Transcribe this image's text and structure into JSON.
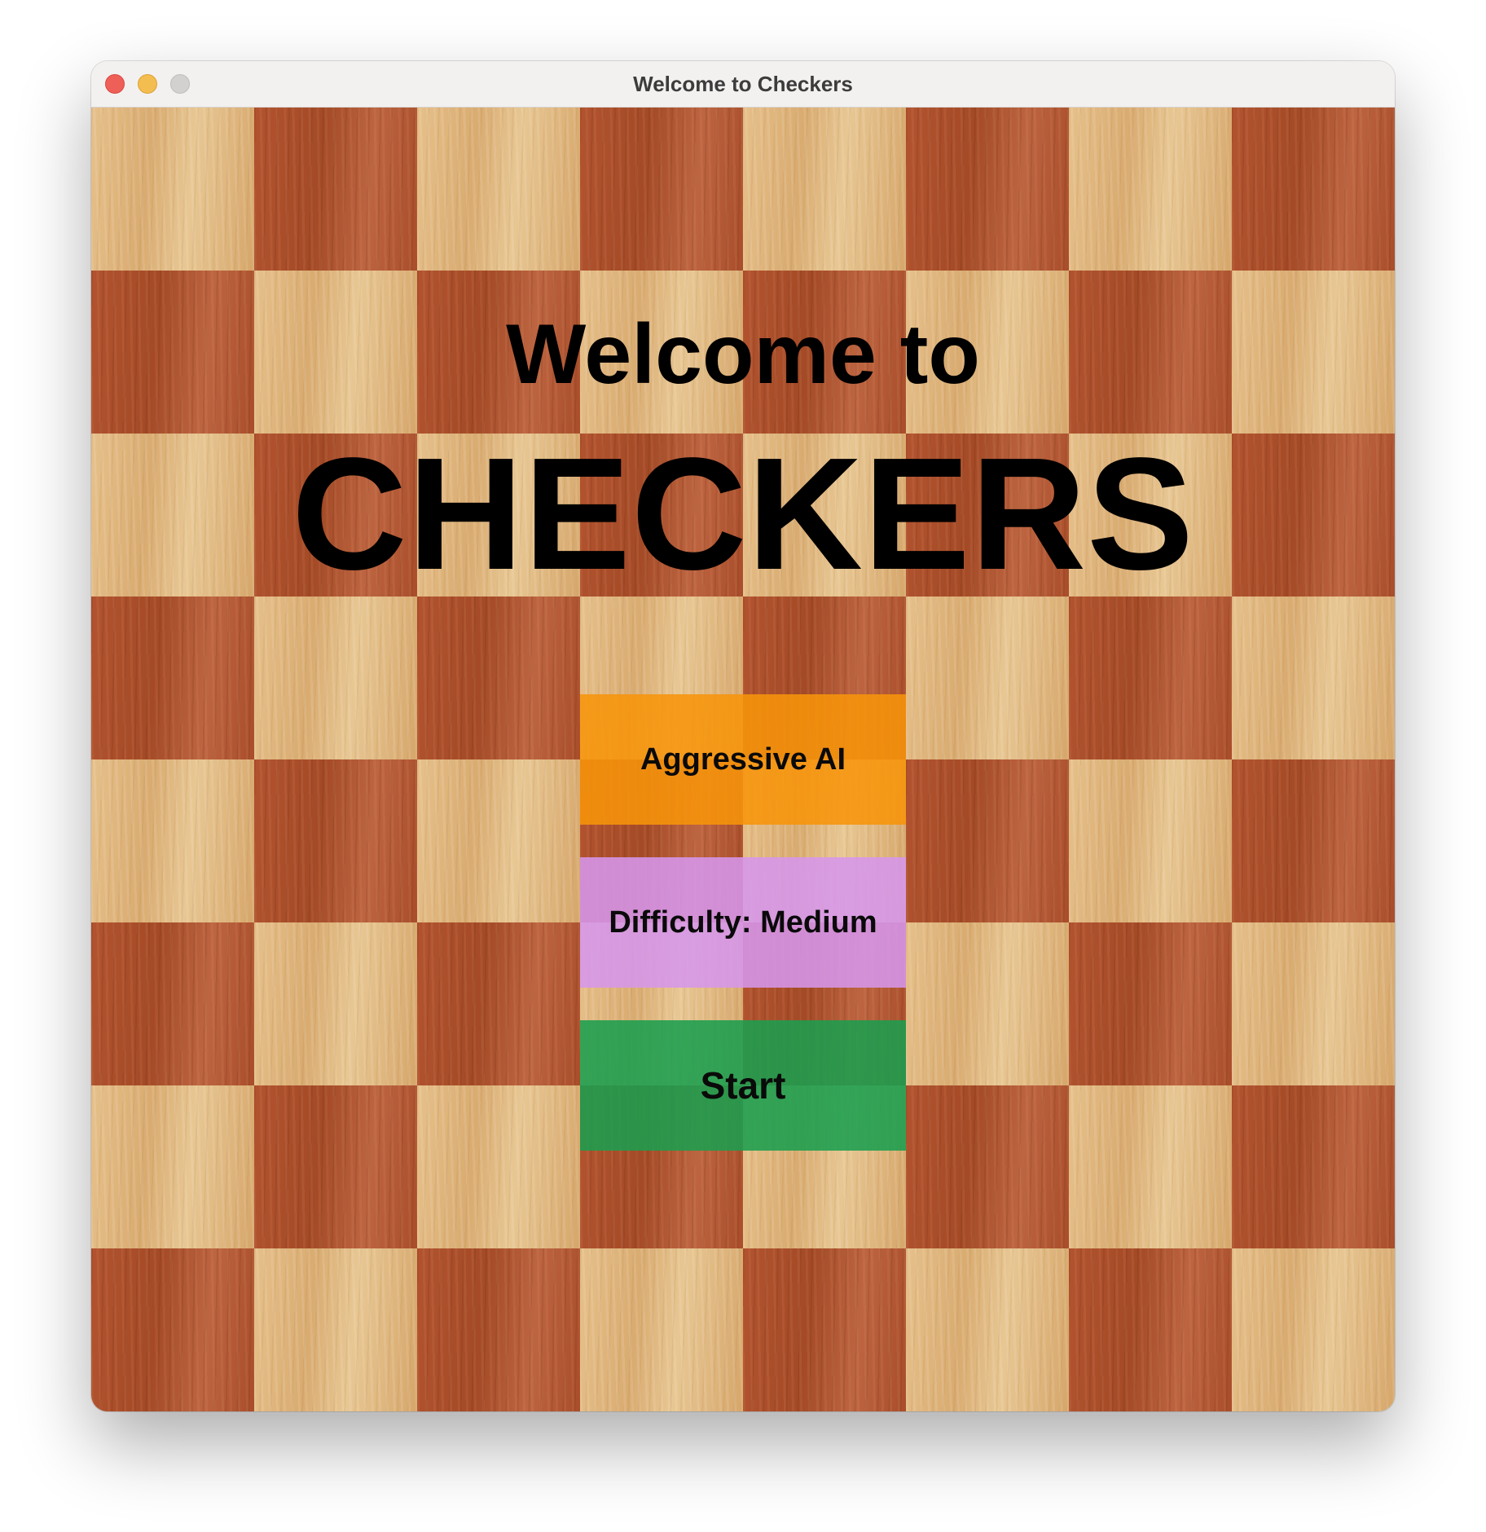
{
  "window": {
    "title": "Welcome to Checkers",
    "controls": [
      "close",
      "minimize",
      "zoom"
    ]
  },
  "board": {
    "rows": 8,
    "columns": 8,
    "light_color": "#e2b881",
    "dark_color": "#ad4f2b"
  },
  "heading": {
    "line1": "Welcome to",
    "line2": "CHECKERS"
  },
  "buttons": {
    "ai_mode": {
      "label": "Aggressive AI",
      "color": "#f7940a"
    },
    "difficulty": {
      "label": "Difficulty: Medium",
      "color": "#d696ec"
    },
    "start": {
      "label": "Start",
      "color": "#1a9e4e"
    }
  }
}
